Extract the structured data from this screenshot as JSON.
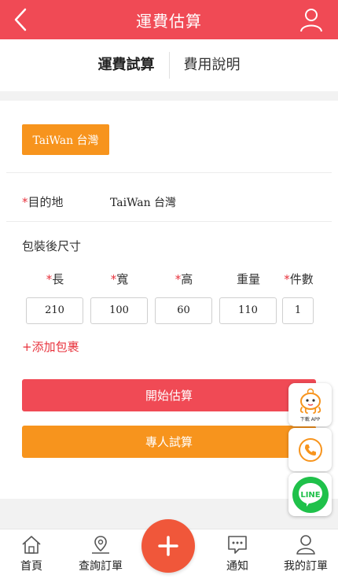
{
  "header": {
    "title": "運費估算"
  },
  "tabs": [
    {
      "label": "運費試算"
    },
    {
      "label": "費用說明"
    }
  ],
  "form": {
    "origin_button": "TaiWan 台灣",
    "destination_label": "目的地",
    "destination_value": "TaiWan 台灣",
    "size_section_label": "包裝後尺寸",
    "columns": [
      {
        "label": "長",
        "required": true,
        "value": "210"
      },
      {
        "label": "寬",
        "required": true,
        "value": "100"
      },
      {
        "label": "高",
        "required": true,
        "value": "60"
      },
      {
        "label": "重量",
        "required": false,
        "value": "110"
      },
      {
        "label": "件數",
        "required": true,
        "value": "1"
      }
    ],
    "add_package": "+添加包裹",
    "start_button": "開始估算",
    "assist_button": "專人試算",
    "required_mark": "*"
  },
  "floating": {
    "app_caption": "下載 APP",
    "line_text": "LINE"
  },
  "bottom_nav": [
    {
      "label": "首頁",
      "icon": "home-icon"
    },
    {
      "label": "查詢訂單",
      "icon": "location-pin-icon"
    },
    {
      "label": "通知",
      "icon": "chat-bubble-icon"
    },
    {
      "label": "我的訂單",
      "icon": "user-icon"
    }
  ],
  "colors": {
    "brand_red": "#f04a55",
    "accent_orange": "#f7941d",
    "line_green": "#1fc14a"
  }
}
